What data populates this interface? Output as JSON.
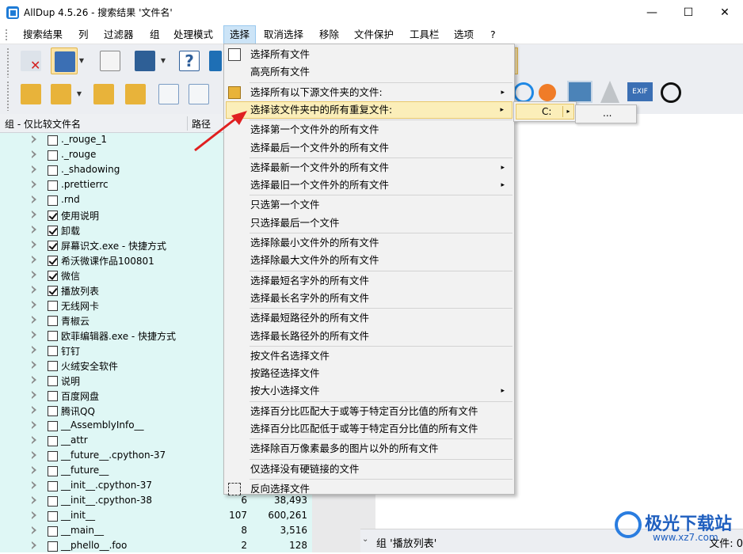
{
  "window": {
    "title": "AllDup 4.5.26 - 搜索结果 '文件名'",
    "minimize_glyph": "—",
    "maximize_glyph": "☐",
    "close_glyph": "✕"
  },
  "menubar": [
    "搜索结果",
    "列",
    "过滤器",
    "组",
    "处理模式",
    "选择",
    "取消选择",
    "移除",
    "文件保护",
    "工具栏",
    "选项",
    "?"
  ],
  "columns": {
    "name": "组 - 仅比较文件名",
    "path": "路径"
  },
  "tree_rows": [
    {
      "label": "._rouge_1",
      "checked": false
    },
    {
      "label": "._rouge",
      "checked": false
    },
    {
      "label": "._shadowing",
      "checked": false
    },
    {
      "label": ".prettierrc",
      "checked": false
    },
    {
      "label": ".rnd",
      "checked": false
    },
    {
      "label": "使用说明",
      "checked": true
    },
    {
      "label": "卸载",
      "checked": true
    },
    {
      "label": "屏幕识文.exe - 快捷方式",
      "checked": true
    },
    {
      "label": "希沃微课作品100801",
      "checked": true
    },
    {
      "label": "微信",
      "checked": true
    },
    {
      "label": "播放列表",
      "checked": true
    },
    {
      "label": "无线网卡",
      "checked": false
    },
    {
      "label": "青椒云",
      "checked": false
    },
    {
      "label": "欧菲编辑器.exe - 快捷方式",
      "checked": false
    },
    {
      "label": "钉钉",
      "checked": false
    },
    {
      "label": "火绒安全软件",
      "checked": false
    },
    {
      "label": "说明",
      "checked": false
    },
    {
      "label": "百度网盘",
      "checked": false
    },
    {
      "label": "腾讯QQ",
      "checked": false
    },
    {
      "label": "__AssemblyInfo__",
      "checked": false
    },
    {
      "label": "__attr",
      "checked": false
    },
    {
      "label": "__future__.cpython-37",
      "checked": false
    },
    {
      "label": "__future__",
      "checked": false
    },
    {
      "label": "__init__.cpython-37",
      "checked": false
    },
    {
      "label": "__init__.cpython-38",
      "checked": false
    },
    {
      "label": "__init__",
      "checked": false
    },
    {
      "label": "__main__",
      "checked": false
    },
    {
      "label": "__phello__.foo",
      "checked": false
    }
  ],
  "mid_rows": [
    {
      "row": 24,
      "count": "6",
      "size": "38,493"
    },
    {
      "row": 25,
      "count": "107",
      "size": "600,261"
    },
    {
      "row": 26,
      "count": "8",
      "size": "3,516"
    },
    {
      "row": 27,
      "count": "2",
      "size": "128"
    }
  ],
  "menu_items": [
    {
      "label": "选择所有文件",
      "icon": "select-all-icon"
    },
    {
      "label": "高亮所有文件"
    },
    {
      "sep": true
    },
    {
      "label": "选择所有以下源文件夹的文件:",
      "submenu": true,
      "icon": "folder-select-icon"
    },
    {
      "label": "选择该文件夹中的所有重复文件:",
      "submenu": true,
      "highlight": true
    },
    {
      "sep": true
    },
    {
      "label": "选择第一个文件外的所有文件"
    },
    {
      "label": "选择最后一个文件外的所有文件"
    },
    {
      "sep": true
    },
    {
      "label": "选择最新一个文件外的所有文件",
      "submenu": true
    },
    {
      "label": "选择最旧一个文件外的所有文件",
      "submenu": true
    },
    {
      "sep": true
    },
    {
      "label": "只选第一个文件"
    },
    {
      "label": "只选择最后一个文件"
    },
    {
      "sep": true
    },
    {
      "label": "选择除最小文件外的所有文件"
    },
    {
      "label": "选择除最大文件外的所有文件"
    },
    {
      "sep": true
    },
    {
      "label": "选择最短名字外的所有文件"
    },
    {
      "label": "选择最长名字外的所有文件"
    },
    {
      "sep": true
    },
    {
      "label": "选择最短路径外的所有文件"
    },
    {
      "label": "选择最长路径外的所有文件"
    },
    {
      "sep": true
    },
    {
      "label": "按文件名选择文件"
    },
    {
      "label": "按路径选择文件"
    },
    {
      "label": "按大小选择文件",
      "submenu": true
    },
    {
      "sep": true
    },
    {
      "label": "选择百分比匹配大于或等于特定百分比值的所有文件"
    },
    {
      "label": "选择百分比匹配低于或等于特定百分比值的所有文件"
    },
    {
      "sep": true
    },
    {
      "label": "选择除百万像素最多的图片以外的所有文件"
    },
    {
      "sep": true
    },
    {
      "label": "仅选择没有硬链接的文件"
    },
    {
      "sep": true
    },
    {
      "label": "反向选择文件",
      "icon": "invert-select-icon"
    }
  ],
  "submenu1": {
    "label": "C:",
    "arrow": "▸"
  },
  "submenu2": {
    "label": "..."
  },
  "submenu_arrow": "▸",
  "status": {
    "group": "组 '播放列表'",
    "file": "文件: 0",
    "caret": "⌄"
  },
  "watermark": {
    "text": "极光下载站",
    "url": "www.xz7.com"
  },
  "colors": {
    "highlight": "#fbeeb9",
    "tree_bg": "#dff7f5",
    "accent": "#1e7bd6",
    "arrow": "#e02020"
  }
}
